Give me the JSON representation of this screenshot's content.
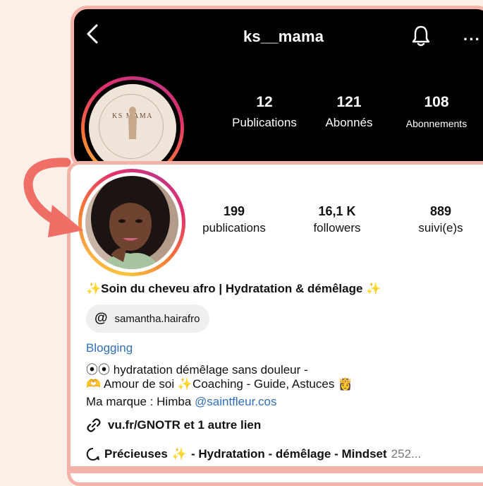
{
  "header": {
    "username": "ks__mama",
    "back_icon": "chevron-left-icon",
    "bell_icon": "bell-icon",
    "more_label": "···"
  },
  "top_profile": {
    "logo_text": "KS MAMA",
    "stats": [
      {
        "value": "12",
        "label": "Publications"
      },
      {
        "value": "121",
        "label": "Abonnés"
      },
      {
        "value": "108",
        "label": "Abonnements"
      }
    ]
  },
  "bottom_profile": {
    "stats": [
      {
        "value": "199",
        "label": "publications"
      },
      {
        "value": "16,1 K",
        "label": "followers"
      },
      {
        "value": "889",
        "label": "suivi(e)s"
      }
    ],
    "bio_title": "Soin du cheveu afro | Hydratation & démêlage",
    "sparkle": "✨",
    "threads_handle": "samantha.hairafro",
    "category": "Blogging",
    "bio_lines": {
      "line1_prefix": "⦿⦿",
      "line1": "hydratation démêlage sans douleur -",
      "line2_part1": "Amour de soi",
      "line2_part2": "Coaching - Guide, Astuces",
      "line3_text": "Ma marque : Himba",
      "line3_mention": "@saintfleur.cos"
    },
    "link_text": "vu.fr/GNOTR et 1 autre lien",
    "highlight_text": "Précieuses",
    "highlight_rest": "- Hydratation - démêlage - Mindset",
    "highlight_count": "252..."
  },
  "colors": {
    "accent_frame": "#f3b3a9",
    "arrow": "#ef6f66",
    "link": "#2f6fb8",
    "background": "#fbefe7"
  }
}
